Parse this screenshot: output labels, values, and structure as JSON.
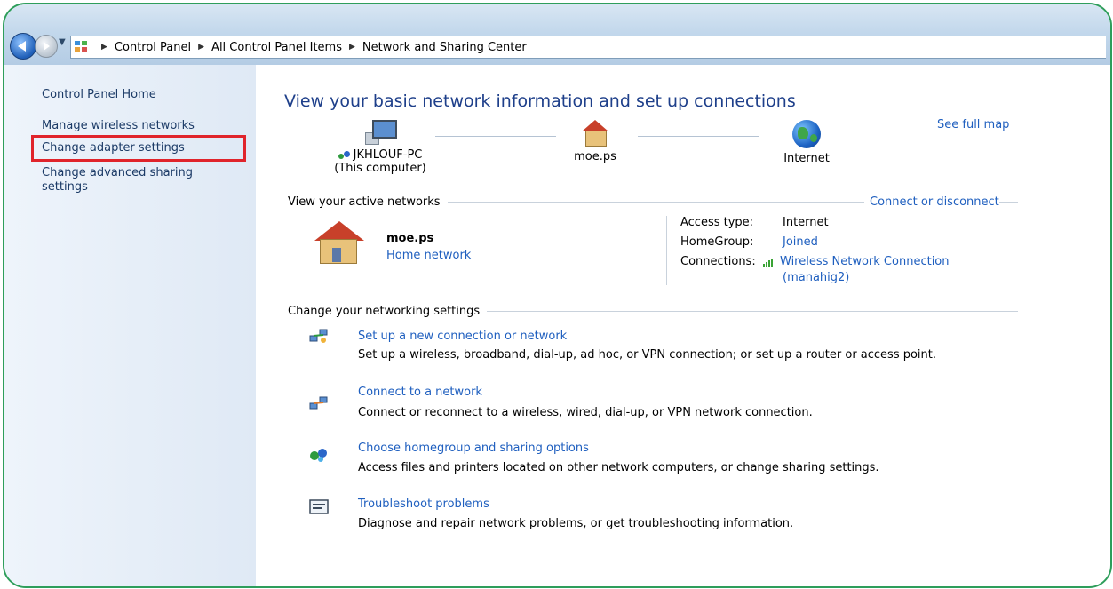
{
  "breadcrumb": {
    "items": [
      "Control Panel",
      "All Control Panel Items",
      "Network and Sharing Center"
    ]
  },
  "sidebar": {
    "home": "Control Panel Home",
    "wireless": "Manage wireless networks",
    "adapter": "Change adapter settings",
    "advanced_line1": "Change advanced sharing",
    "advanced_line2": "settings"
  },
  "main": {
    "title": "View your basic network information and set up connections",
    "see_full_map": "See full map",
    "map": {
      "pc_name": "JKHLOUF-PC",
      "pc_sub": "(This computer)",
      "home_name": "moe.ps",
      "internet": "Internet"
    },
    "active": {
      "header": "View your active networks",
      "connect_link": "Connect or disconnect",
      "network_name": "moe.ps",
      "network_type": "Home network",
      "access_label": "Access type:",
      "access_value": "Internet",
      "homegroup_label": "HomeGroup:",
      "homegroup_value": "Joined",
      "connections_label": "Connections:",
      "connections_value_1": "Wireless Network Connection",
      "connections_value_2": "(manahig2)"
    },
    "settings": {
      "header": "Change your networking settings",
      "tasks": [
        {
          "title": "Set up a new connection or network",
          "desc": "Set up a wireless, broadband, dial-up, ad hoc, or VPN connection; or set up a router or access point."
        },
        {
          "title": "Connect to a network",
          "desc": "Connect or reconnect to a wireless, wired, dial-up, or VPN network connection."
        },
        {
          "title": "Choose homegroup and sharing options",
          "desc": "Access files and printers located on other network computers, or change sharing settings."
        },
        {
          "title": "Troubleshoot problems",
          "desc": "Diagnose and repair network problems, or get troubleshooting information."
        }
      ]
    }
  },
  "colors": {
    "frame_border": "#2e9e5b",
    "link": "#1f5fbf",
    "title": "#1e3f8a",
    "highlight": "#e0242b"
  }
}
